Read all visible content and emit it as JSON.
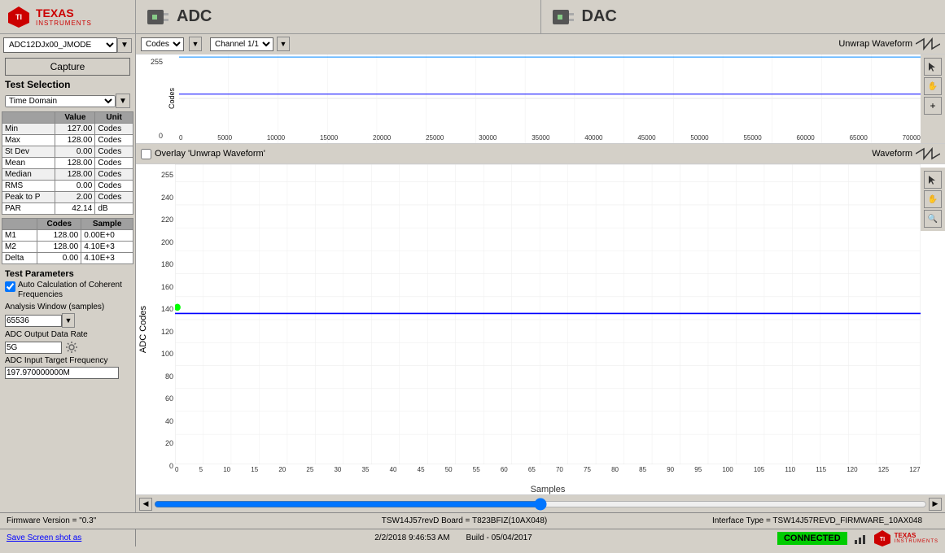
{
  "logo": {
    "name": "TEXAS",
    "sub": "INSTRUMENTS"
  },
  "header": {
    "adc_label": "ADC",
    "dac_label": "DAC"
  },
  "left": {
    "device": "ADC12DJx00_JMODE",
    "capture_btn": "Capture",
    "test_selection_label": "Test Selection",
    "domain_label": "Time Domain",
    "stats": {
      "headers": [
        "Value",
        "Unit"
      ],
      "rows": [
        {
          "label": "Min",
          "value": "127.00",
          "unit": "Codes"
        },
        {
          "label": "Max",
          "value": "128.00",
          "unit": "Codes"
        },
        {
          "label": "St Dev",
          "value": "0.00",
          "unit": "Codes"
        },
        {
          "label": "Mean",
          "value": "128.00",
          "unit": "Codes"
        },
        {
          "label": "Median",
          "value": "128.00",
          "unit": "Codes"
        },
        {
          "label": "RMS",
          "value": "0.00",
          "unit": "Codes"
        },
        {
          "label": "Peak to P",
          "value": "2.00",
          "unit": "Codes"
        },
        {
          "label": "PAR",
          "value": "42.14",
          "unit": "dB"
        }
      ]
    },
    "markers": {
      "headers": [
        "",
        "Codes",
        "Sample"
      ],
      "rows": [
        {
          "label": "M1",
          "codes": "128.00",
          "sample": "0.00E+0"
        },
        {
          "label": "M2",
          "codes": "128.00",
          "sample": "4.10E+3"
        },
        {
          "label": "Delta",
          "codes": "0.00",
          "sample": "4.10E+3"
        }
      ]
    },
    "test_params": {
      "title": "Test Parameters",
      "auto_calc_label": "Auto Calculation of Coherent Frequencies",
      "analysis_label": "Analysis Window (samples)",
      "analysis_value": "65536",
      "output_rate_label": "ADC Output Data Rate",
      "output_rate_value": "5G",
      "input_freq_label": "ADC Input Target Frequency",
      "input_freq_value": "197.970000000M"
    }
  },
  "top_chart": {
    "codes_dropdown": "Codes",
    "channel_dropdown": "Channel 1/1",
    "unwrap_label": "Unwrap Waveform",
    "y_labels": [
      "255",
      "0"
    ],
    "x_labels": [
      "0",
      "5000",
      "10000",
      "15000",
      "20000",
      "25000",
      "30000",
      "35000",
      "40000",
      "45000",
      "50000",
      "55000",
      "60000",
      "65000",
      "70000"
    ]
  },
  "bottom_chart": {
    "overlay_label": "Overlay 'Unwrap Waveform'",
    "waveform_label": "Waveform",
    "y_label": "ADC Codes",
    "x_label": "Samples",
    "y_labels": [
      "255",
      "240",
      "220",
      "200",
      "180",
      "160",
      "140",
      "120",
      "100",
      "80",
      "60",
      "40",
      "20",
      "0"
    ],
    "x_labels": [
      "0",
      "5",
      "10",
      "15",
      "20",
      "25",
      "30",
      "35",
      "40",
      "45",
      "50",
      "55",
      "60",
      "65",
      "70",
      "75",
      "80",
      "85",
      "90",
      "95",
      "100",
      "105",
      "110",
      "115",
      "120",
      "125",
      "127"
    ]
  },
  "status_bar": {
    "firmware": "Firmware Version = \"0.3\"",
    "board": "TSW14J57revD Board = T823BFIZ(10AX048)",
    "interface": "Interface Type = TSW14J57REVD_FIRMWARE_10AX048"
  },
  "bottom_bar": {
    "save_label": "Save Screen shot as",
    "datetime": "2/2/2018 9:46:53 AM",
    "build": "Build - 05/04/2017",
    "connected": "CONNECTED"
  }
}
